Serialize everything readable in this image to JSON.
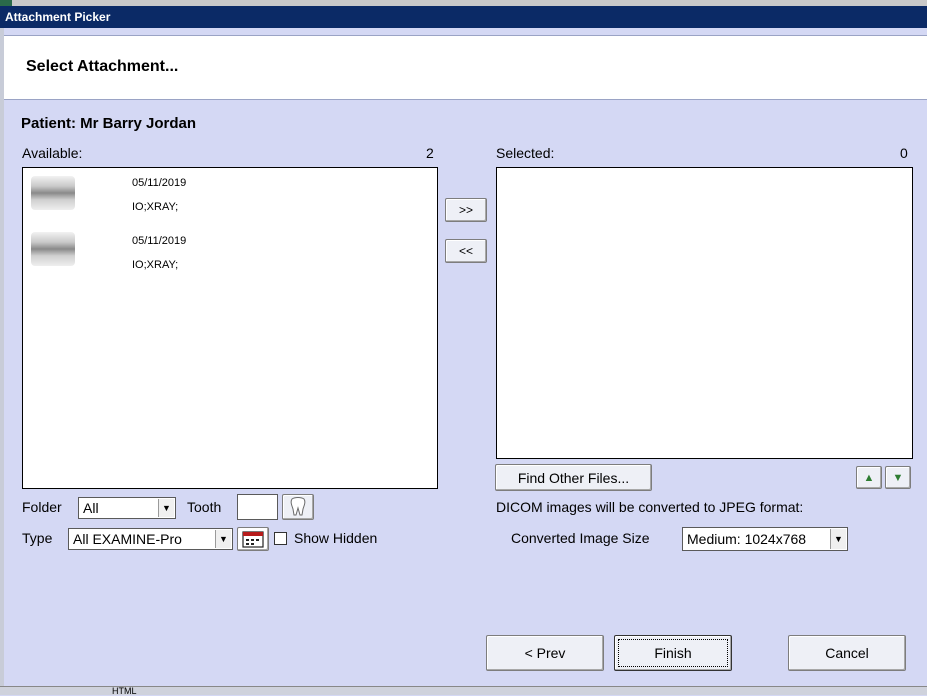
{
  "window": {
    "title": "Attachment Picker"
  },
  "header": {
    "title": "Select Attachment..."
  },
  "patient": {
    "label": "Patient: Mr Barry Jordan"
  },
  "available": {
    "label": "Available:",
    "count": "2",
    "items": [
      {
        "date": "05/11/2019",
        "tags": "IO;XRAY;"
      },
      {
        "date": "05/11/2019",
        "tags": "IO;XRAY;"
      }
    ]
  },
  "selected": {
    "label": "Selected:",
    "count": "0"
  },
  "buttons": {
    "add": ">>",
    "remove": "<<",
    "find_files": "Find Other Files...",
    "move_up": "▲",
    "move_down": "▼",
    "prev": "< Prev",
    "finish": "Finish",
    "cancel": "Cancel"
  },
  "filters": {
    "folder_label": "Folder",
    "folder_value": "All",
    "tooth_label": "Tooth",
    "tooth_value": "",
    "type_label": "Type",
    "type_value": "All EXAMINE-Pro",
    "show_hidden_label": "Show Hidden"
  },
  "conversion": {
    "note": "DICOM images will be converted to JPEG format:",
    "size_label": "Converted Image Size",
    "size_value": "Medium: 1024x768"
  },
  "taskbar": {
    "item": "HTML"
  }
}
